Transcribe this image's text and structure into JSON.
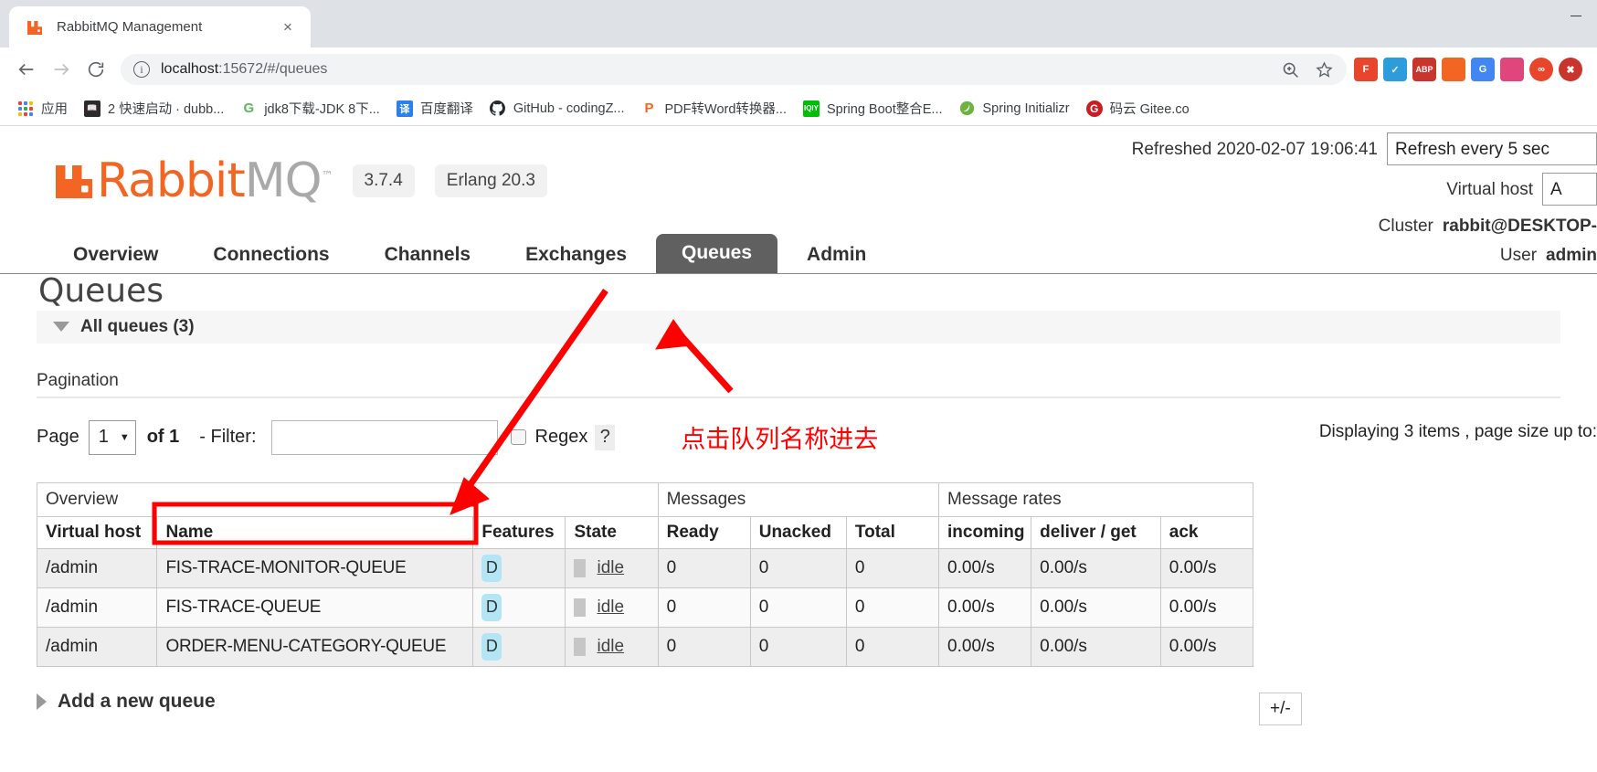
{
  "browser": {
    "tab": {
      "title": "RabbitMQ Management",
      "favicon": "rabbitmq-icon",
      "close_label": "×"
    },
    "window_controls": {
      "minimize": "minimize-icon"
    },
    "nav": {
      "back": "back-arrow-icon",
      "forward": "forward-arrow-icon",
      "reload": "reload-icon"
    },
    "omnibox": {
      "info_icon": "ⓘ",
      "url_host": "localhost",
      "url_path": ":15672/#/queues",
      "zoom_icon": "zoom-icon",
      "star_icon": "☆"
    },
    "extensions": [
      {
        "name": "feedly-extension",
        "label": "F",
        "color": "#e8452c"
      },
      {
        "name": "check-extension",
        "label": "✓",
        "color": "#2d9cdb"
      },
      {
        "name": "adblock-plus-extension",
        "label": "ABP",
        "color": "#c9352c"
      },
      {
        "name": "notes-extension",
        "label": "",
        "color": "#f26522"
      },
      {
        "name": "google-translate-extension",
        "label": "G",
        "color": "#4285f4"
      },
      {
        "name": "colorful-extension",
        "label": "",
        "color": "#e0457b"
      },
      {
        "name": "infinity-extension",
        "label": "∞",
        "color": "#e8452c"
      },
      {
        "name": "stop-extension",
        "label": "✖",
        "color": "#c9352c"
      }
    ],
    "bookmarks": [
      {
        "name": "apps-bookmark",
        "label": "应用",
        "icon": "apps-grid-icon",
        "icon_color": "#4285f4"
      },
      {
        "name": "dubbo-bookmark",
        "label": "2 快速启动 · dubb...",
        "icon": "book-icon",
        "icon_color": "#2b2b2b"
      },
      {
        "name": "jdk8-bookmark",
        "label": "jdk8下载-JDK 8下...",
        "icon": "g-icon",
        "icon_color": "#5cb85c"
      },
      {
        "name": "baidu-translate-bookmark",
        "label": "百度翻译",
        "icon": "translate-icon",
        "icon_color": "#2d7ff0"
      },
      {
        "name": "github-bookmark",
        "label": "GitHub - codingZ...",
        "icon": "github-icon",
        "icon_color": "#24292e"
      },
      {
        "name": "pdf2word-bookmark",
        "label": "PDF转Word转换器...",
        "icon": "pdf-icon",
        "icon_color": "#f26522"
      },
      {
        "name": "spring-boot-bookmark",
        "label": "Spring Boot整合E...",
        "icon": "iqiyi-icon",
        "icon_color": "#00be06"
      },
      {
        "name": "spring-initializr-bookmark",
        "label": "Spring Initializr",
        "icon": "spring-leaf-icon",
        "icon_color": "#6db33f"
      },
      {
        "name": "gitee-bookmark",
        "label": "码云 Gitee.co",
        "icon": "gitee-icon",
        "icon_color": "#c71d23"
      }
    ]
  },
  "rabbitmq": {
    "logo": {
      "word_primary": "Rabbit",
      "word_secondary": "MQ",
      "tm": "™"
    },
    "version_badge": "3.7.4",
    "erlang_badge": "Erlang 20.3",
    "header_right": {
      "refreshed_label": "Refreshed 2020-02-07 19:06:41",
      "refresh_select": "Refresh every 5 sec",
      "vhost_label": "Virtual host",
      "vhost_select": "A",
      "cluster_label": "Cluster",
      "cluster_value": "rabbit@DESKTOP-",
      "user_label": "User",
      "user_value": "admin"
    },
    "nav_tabs": [
      {
        "name": "tab-overview",
        "label": "Overview",
        "active": false
      },
      {
        "name": "tab-connections",
        "label": "Connections",
        "active": false
      },
      {
        "name": "tab-channels",
        "label": "Channels",
        "active": false
      },
      {
        "name": "tab-exchanges",
        "label": "Exchanges",
        "active": false
      },
      {
        "name": "tab-queues",
        "label": "Queues",
        "active": true
      },
      {
        "name": "tab-admin",
        "label": "Admin",
        "active": false
      }
    ],
    "page_title": "Queues",
    "all_queues_section": "All queues (3)",
    "pagination_label": "Pagination",
    "controls": {
      "page_label": "Page",
      "page_value": "1",
      "of_label": "of 1",
      "filter_label": "- Filter:",
      "filter_value": "",
      "filter_placeholder": "",
      "regex_label": "Regex",
      "help_label": "?",
      "displaying": "Displaying 3 items , page size up to:"
    },
    "annotation_cn": "点击队列名称进去",
    "table": {
      "group_headers": [
        {
          "label": "Overview",
          "span": 4
        },
        {
          "label": "Messages",
          "span": 3
        },
        {
          "label": "Message rates",
          "span": 3
        }
      ],
      "columns": [
        "Virtual host",
        "Name",
        "Features",
        "State",
        "Ready",
        "Unacked",
        "Total",
        "incoming",
        "deliver / get",
        "ack"
      ],
      "plus_minus": "+/-",
      "rows": [
        {
          "vhost": "/admin",
          "name": "FIS-TRACE-MONITOR-QUEUE",
          "features": "D",
          "state": "idle",
          "ready": "0",
          "unacked": "0",
          "total": "0",
          "incoming": "0.00/s",
          "deliver_get": "0.00/s",
          "ack": "0.00/s",
          "highlighted": false
        },
        {
          "vhost": "/admin",
          "name": "FIS-TRACE-QUEUE",
          "features": "D",
          "state": "idle",
          "ready": "0",
          "unacked": "0",
          "total": "0",
          "incoming": "0.00/s",
          "deliver_get": "0.00/s",
          "ack": "0.00/s",
          "highlighted": false
        },
        {
          "vhost": "/admin",
          "name": "ORDER-MENU-CATEGORY-QUEUE",
          "features": "D",
          "state": "idle",
          "ready": "0",
          "unacked": "0",
          "total": "0",
          "incoming": "0.00/s",
          "deliver_get": "0.00/s",
          "ack": "0.00/s",
          "highlighted": true
        }
      ]
    },
    "add_queue_label": "Add a new queue"
  },
  "colors": {
    "accent_orange": "#f26522",
    "annotation_red": "#ff0000",
    "active_tab_bg": "#606060",
    "feature_badge_bg": "#b3e5f5"
  }
}
